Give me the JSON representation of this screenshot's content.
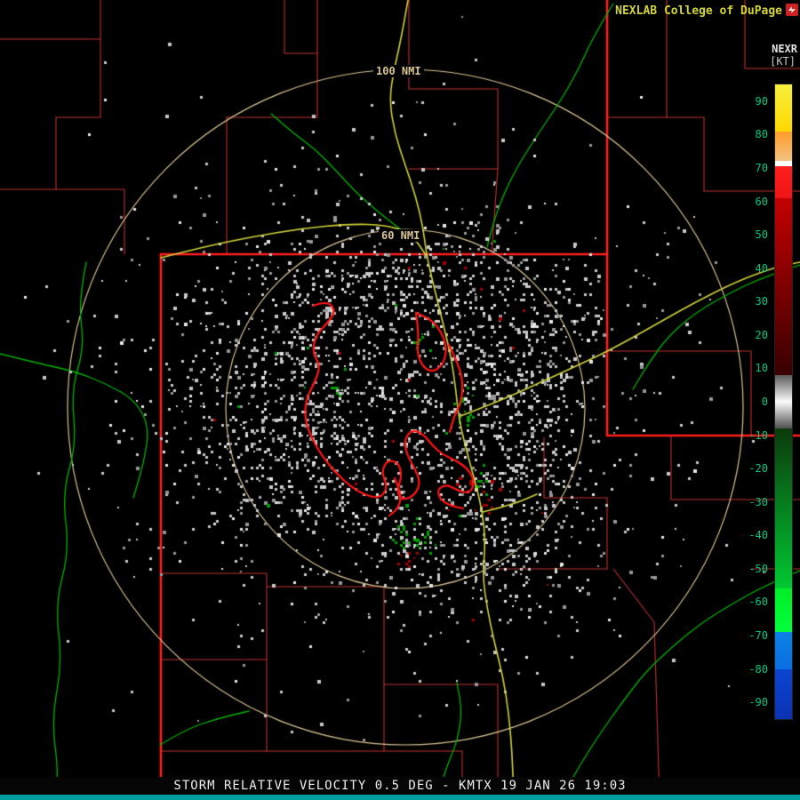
{
  "header": {
    "brand": "NEXLAB College of DuPage"
  },
  "colorbar": {
    "title": "NEXR",
    "units": "[KT]",
    "tick_color": "#00c882",
    "top_value": 95,
    "bottom_value": -95,
    "tick_labels": [
      "90",
      "80",
      "70",
      "60",
      "50",
      "40",
      "30",
      "20",
      "10",
      "0",
      "-10",
      "-20",
      "-30",
      "-40",
      "-50",
      "-60",
      "-70",
      "-80",
      "-90"
    ],
    "segments": [
      {
        "from": 95,
        "to": 81,
        "top": "#f6ef3e",
        "bottom": "#ffd800"
      },
      {
        "from": 81,
        "to": 72,
        "top": "#ff9c28",
        "bottom": "#f2c284"
      },
      {
        "from": 72,
        "to": 70.5,
        "top": "#ffffff",
        "bottom": "#ffffff"
      },
      {
        "from": 70.5,
        "to": 61,
        "top": "#ff2020",
        "bottom": "#f01414"
      },
      {
        "from": 61,
        "to": 8,
        "top": "#c40000",
        "bottom": "#380000"
      },
      {
        "from": 8,
        "to": 0,
        "top": "#5a5a5a",
        "bottom": "#fbfbfb"
      },
      {
        "from": 0,
        "to": -8,
        "top": "#fbfbfb",
        "bottom": "#505050"
      },
      {
        "from": -8,
        "to": -56,
        "top": "#0c3a0c",
        "bottom": "#00c832"
      },
      {
        "from": -56,
        "to": -69,
        "top": "#00ee28",
        "bottom": "#00ff3c"
      },
      {
        "from": -69,
        "to": -80,
        "top": "#0a82e6",
        "bottom": "#0a6ee0"
      },
      {
        "from": -80,
        "to": -95,
        "top": "#0a46d2",
        "bottom": "#0a32b4"
      }
    ]
  },
  "map": {
    "range_ring_labels": [
      {
        "label": "100 NMI"
      },
      {
        "label": "60 NMI"
      }
    ],
    "colors": {
      "background": "#000000",
      "range_ring": "#d9c493",
      "state_border": "#ff1e1e",
      "county_border": "#c03030",
      "river": "#00b400",
      "highway": "#cfd23a",
      "lake_outline": "#ff1414",
      "echo_gray_1": "#c8c8c8",
      "echo_gray_2": "#969696",
      "echo_gray_3": "#e6e6e6",
      "echo_green": "#00a000",
      "echo_red": "#aa0000"
    }
  },
  "statusbar": {
    "text": "STORM RELATIVE VELOCITY 0.5 DEG - KMTX 19 JAN 26 19:03"
  }
}
